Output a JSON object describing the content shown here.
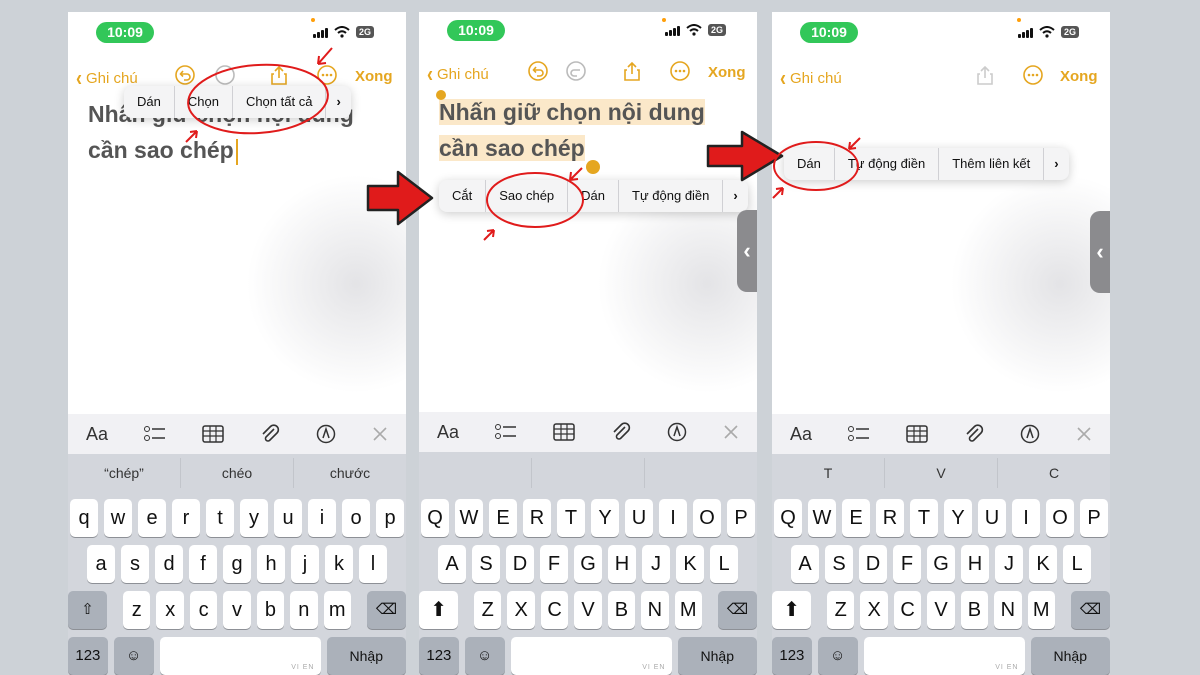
{
  "colors": {
    "accent": "#e5a620",
    "annotation": "#e01b1b",
    "status_green": "#32c759"
  },
  "panels": [
    {
      "status_time": "10:09",
      "network": "2G",
      "nav": {
        "back_label": "Ghi chú",
        "done_label": "Xong"
      },
      "note_lines": [
        "Nhấn giữ chọn nội dung",
        "cần sao chép"
      ],
      "menu": [
        "Dán",
        "Chọn",
        "Chọn tất cả",
        "›"
      ],
      "suggestions": [
        "“chép”",
        "chéo",
        "chước"
      ],
      "keyboard": {
        "row1": [
          "q",
          "w",
          "e",
          "r",
          "t",
          "y",
          "u",
          "i",
          "o",
          "p"
        ],
        "row2": [
          "a",
          "s",
          "d",
          "f",
          "g",
          "h",
          "j",
          "k",
          "l"
        ],
        "row3": [
          "z",
          "x",
          "c",
          "v",
          "b",
          "n",
          "m"
        ],
        "numbers_label": "123",
        "space_hint": "VI EN",
        "enter_label": "Nhập"
      }
    },
    {
      "status_time": "10:09",
      "network": "2G",
      "nav": {
        "back_label": "Ghi chú",
        "done_label": "Xong"
      },
      "note_lines": [
        "Nhấn giữ chọn nội dung",
        "cần sao chép"
      ],
      "menu": [
        "Cắt",
        "Sao chép",
        "Dán",
        "Tự động điền",
        "›"
      ],
      "suggestions": [
        "",
        "",
        ""
      ],
      "keyboard": {
        "row1": [
          "Q",
          "W",
          "E",
          "R",
          "T",
          "Y",
          "U",
          "I",
          "O",
          "P"
        ],
        "row2": [
          "A",
          "S",
          "D",
          "F",
          "G",
          "H",
          "J",
          "K",
          "L"
        ],
        "row3": [
          "Z",
          "X",
          "C",
          "V",
          "B",
          "N",
          "M"
        ],
        "numbers_label": "123",
        "space_hint": "VI EN",
        "enter_label": "Nhập"
      }
    },
    {
      "status_time": "10:09",
      "network": "2G",
      "nav": {
        "back_label": "Ghi chú",
        "done_label": "Xong"
      },
      "note_lines": [],
      "menu": [
        "Dán",
        "Tự động điền",
        "Thêm liên kết",
        "›"
      ],
      "suggestions": [
        "T",
        "V",
        "C"
      ],
      "keyboard": {
        "row1": [
          "Q",
          "W",
          "E",
          "R",
          "T",
          "Y",
          "U",
          "I",
          "O",
          "P"
        ],
        "row2": [
          "A",
          "S",
          "D",
          "F",
          "G",
          "H",
          "J",
          "K",
          "L"
        ],
        "row3": [
          "Z",
          "X",
          "C",
          "V",
          "B",
          "N",
          "M"
        ],
        "numbers_label": "123",
        "space_hint": "VI EN",
        "enter_label": "Nhập"
      }
    }
  ]
}
